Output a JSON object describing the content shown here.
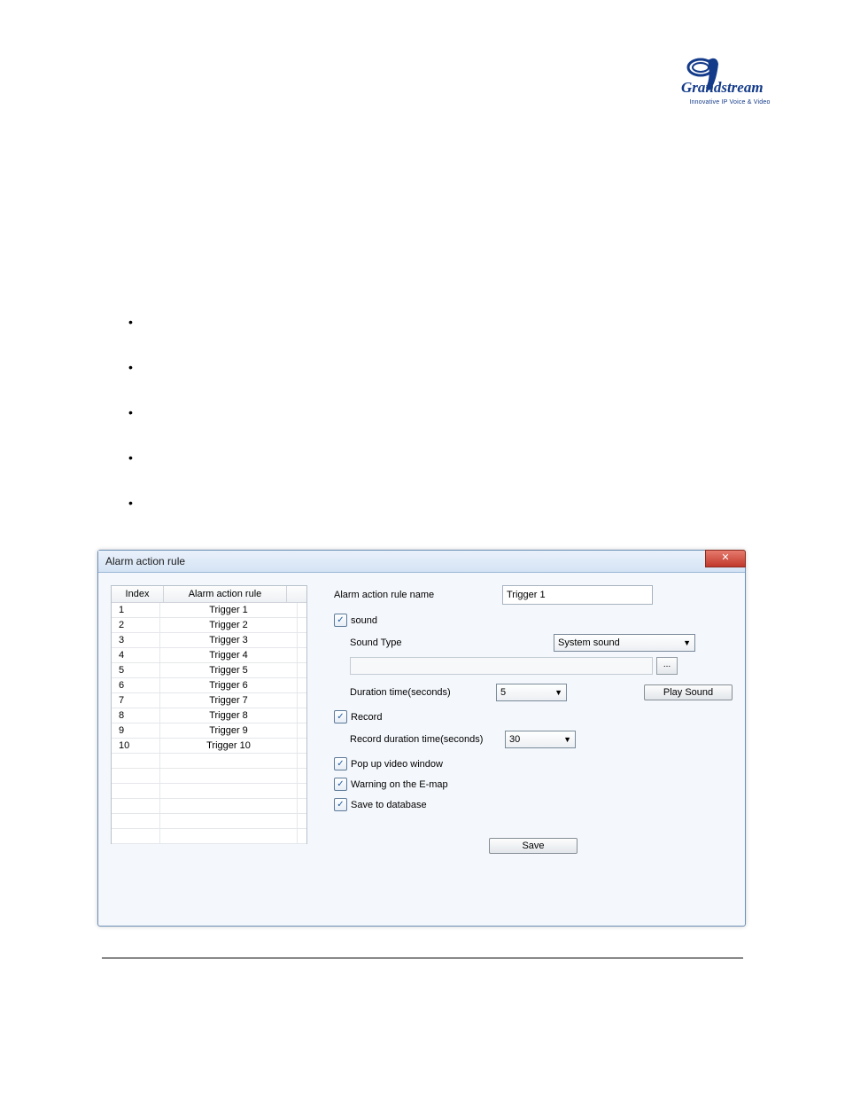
{
  "logo": {
    "brand": "Grandstream",
    "tagline": "Innovative IP Voice & Video"
  },
  "dialog": {
    "title": "Alarm action rule",
    "close": "✕",
    "table": {
      "headers": {
        "index": "Index",
        "rule": "Alarm action rule"
      },
      "rows": [
        {
          "index": "1",
          "rule": "Trigger 1"
        },
        {
          "index": "2",
          "rule": "Trigger 2"
        },
        {
          "index": "3",
          "rule": "Trigger 3"
        },
        {
          "index": "4",
          "rule": "Trigger 4"
        },
        {
          "index": "5",
          "rule": "Trigger 5"
        },
        {
          "index": "6",
          "rule": "Trigger 6"
        },
        {
          "index": "7",
          "rule": "Trigger 7"
        },
        {
          "index": "8",
          "rule": "Trigger 8"
        },
        {
          "index": "9",
          "rule": "Trigger 9"
        },
        {
          "index": "10",
          "rule": "Trigger 10"
        }
      ]
    },
    "form": {
      "name_label": "Alarm action rule name",
      "name_value": "Trigger 1",
      "sound_label": "sound",
      "sound_type_label": "Sound Type",
      "sound_type_value": "System sound",
      "duration_label": "Duration time(seconds)",
      "duration_value": "5",
      "play_sound": "Play Sound",
      "record_label": "Record",
      "record_duration_label": "Record duration time(seconds)",
      "record_duration_value": "30",
      "popup_label": "Pop up video window",
      "warning_label": "Warning on the E-map",
      "savedb_label": "Save to database",
      "save": "Save",
      "browse": "..."
    }
  }
}
